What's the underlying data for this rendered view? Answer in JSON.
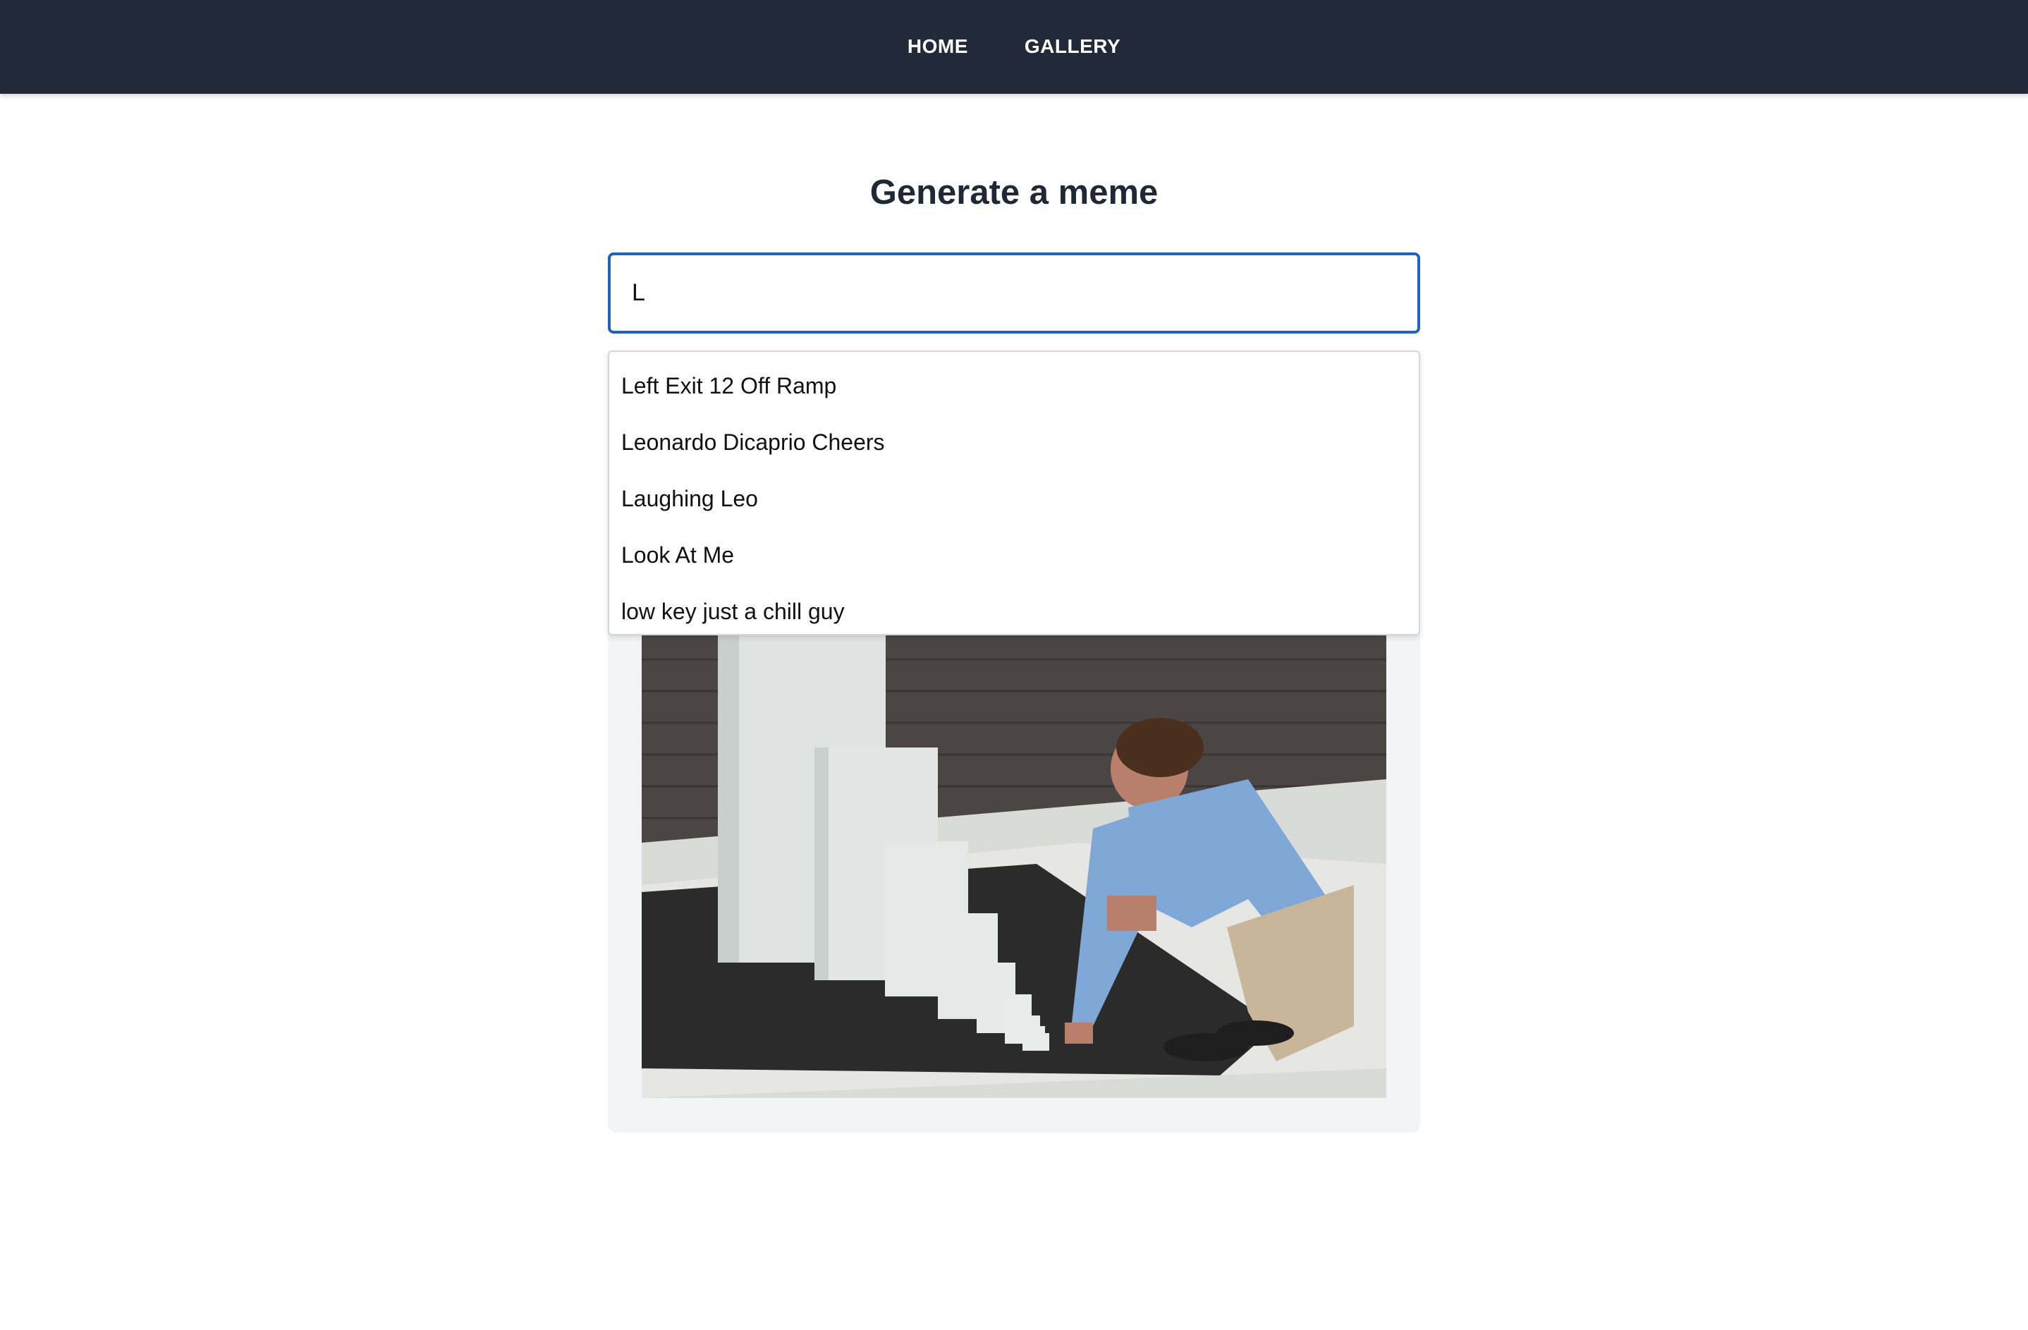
{
  "nav": {
    "items": [
      {
        "label": "HOME"
      },
      {
        "label": "GALLERY"
      }
    ]
  },
  "page": {
    "title": "Generate a meme"
  },
  "search": {
    "value": "L",
    "placeholder": ""
  },
  "suggestions": [
    {
      "label": "Left Exit 12 Off Ramp"
    },
    {
      "label": "Leonardo Dicaprio Cheers"
    },
    {
      "label": "Laughing Leo"
    },
    {
      "label": "Look At Me"
    },
    {
      "label": "low key just a chill guy"
    }
  ],
  "colors": {
    "navbar": "#222a3a",
    "focus_border": "#1e63c3",
    "card": "#f3f4f6",
    "title": "#1f2837"
  }
}
